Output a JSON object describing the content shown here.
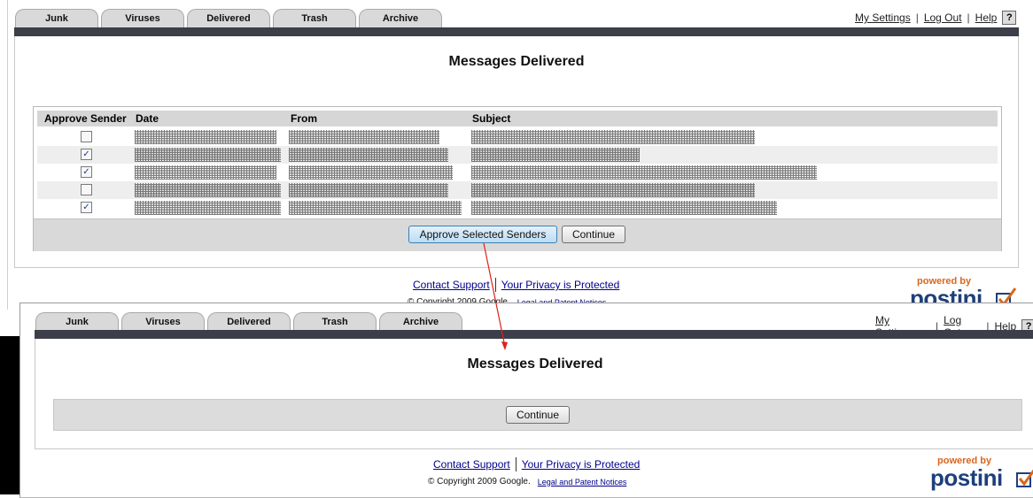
{
  "tabs": [
    "Junk",
    "Viruses",
    "Delivered",
    "Trash",
    "Archive"
  ],
  "toplinks": {
    "settings": "My Settings",
    "logout": "Log Out",
    "help": "Help",
    "help_icon": "?"
  },
  "screen1": {
    "title": "Messages Delivered",
    "table": {
      "headers": [
        "Approve Sender",
        "Date",
        "From",
        "Subject"
      ],
      "rows": [
        {
          "checked": false
        },
        {
          "checked": true
        },
        {
          "checked": true
        },
        {
          "checked": false
        },
        {
          "checked": true
        }
      ]
    },
    "approve_button": "Approve Selected Senders",
    "continue_button": "Continue"
  },
  "screen2": {
    "title": "Messages Delivered",
    "continue_button": "Continue"
  },
  "footer": {
    "contact": "Contact Support",
    "privacy": "Your Privacy is Protected",
    "copyright": "© Copyright 2009 Google.",
    "legal": "Legal and Patent Notices"
  },
  "logo": {
    "powered": "powered by",
    "name": "postini"
  },
  "colors": {
    "accent_bar": "#3c3e4a",
    "logo_orange": "#d9661f",
    "logo_blue": "#1d3f7c",
    "arrow": "#e0201a"
  }
}
